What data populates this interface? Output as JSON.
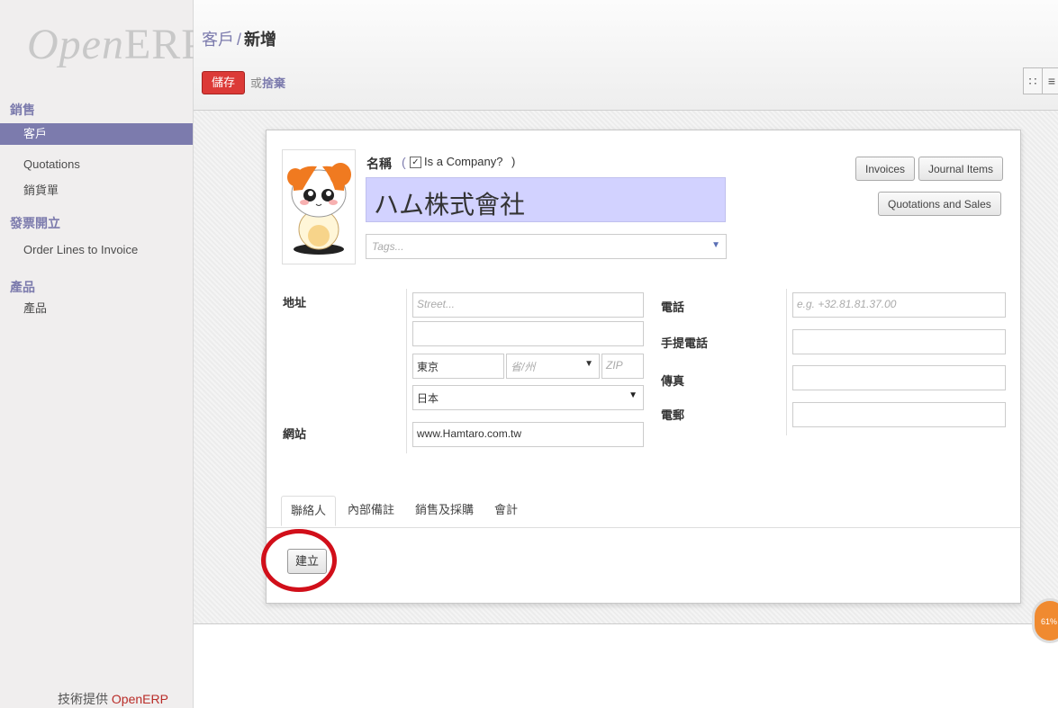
{
  "app": {
    "logo_text": "OpenERP",
    "logo_open": "Open",
    "logo_erp": "ERP",
    "powered_by": "技術提供",
    "powered_brand": "OpenERP"
  },
  "sidebar": {
    "sections": [
      {
        "title": "銷售",
        "items": [
          {
            "label": "客戶",
            "active": true
          },
          {
            "label": "Quotations",
            "active": false
          },
          {
            "label": "銷貨單",
            "active": false
          }
        ]
      },
      {
        "title": "發票開立",
        "items": [
          {
            "label": "Order Lines to Invoice",
            "active": false
          }
        ]
      },
      {
        "title": "產品",
        "items": [
          {
            "label": "產品",
            "active": false
          }
        ]
      }
    ]
  },
  "header": {
    "breadcrumb_parent": "客戶",
    "breadcrumb_sep": "/",
    "breadcrumb_current": "新增",
    "save_label": "儲存",
    "or_text": "或",
    "discard_label": "捨棄",
    "view_kanban_icon": "kanban-icon",
    "view_list_icon": "list-icon"
  },
  "form": {
    "name_label": "名稱",
    "paren_open": "(",
    "paren_close": ")",
    "is_company_label": "Is a Company?",
    "is_company_checked": true,
    "name_value": "ハム株式會社",
    "tags_placeholder": "Tags...",
    "stat_buttons": {
      "invoices": "Invoices",
      "journal_items": "Journal Items",
      "quotations_sales": "Quotations and Sales"
    },
    "address_label": "地址",
    "street_placeholder": "Street...",
    "street2_value": "",
    "city_value": "東京",
    "state_placeholder": "省/州",
    "zip_placeholder": "ZIP",
    "country_value": "日本",
    "website_label": "網站",
    "website_value": "www.Hamtaro.com.tw",
    "phone_label": "電話",
    "phone_placeholder": "e.g. +32.81.81.37.00",
    "mobile_label": "手提電話",
    "mobile_value": "",
    "fax_label": "傳真",
    "fax_value": "",
    "email_label": "電郵",
    "email_value": ""
  },
  "tabs": [
    {
      "label": "聯絡人",
      "active": true
    },
    {
      "label": "內部備註",
      "active": false
    },
    {
      "label": "銷售及採購",
      "active": false
    },
    {
      "label": "會計",
      "active": false
    }
  ],
  "create_label": "建立",
  "progress": {
    "text": "61%",
    "value": 61
  },
  "colors": {
    "accent": "#7c7bad",
    "save_red": "#dc3a37",
    "name_bg": "#d2d2ff",
    "highlight_ring": "#d10f1a",
    "badge_orange": "#f08a30"
  }
}
